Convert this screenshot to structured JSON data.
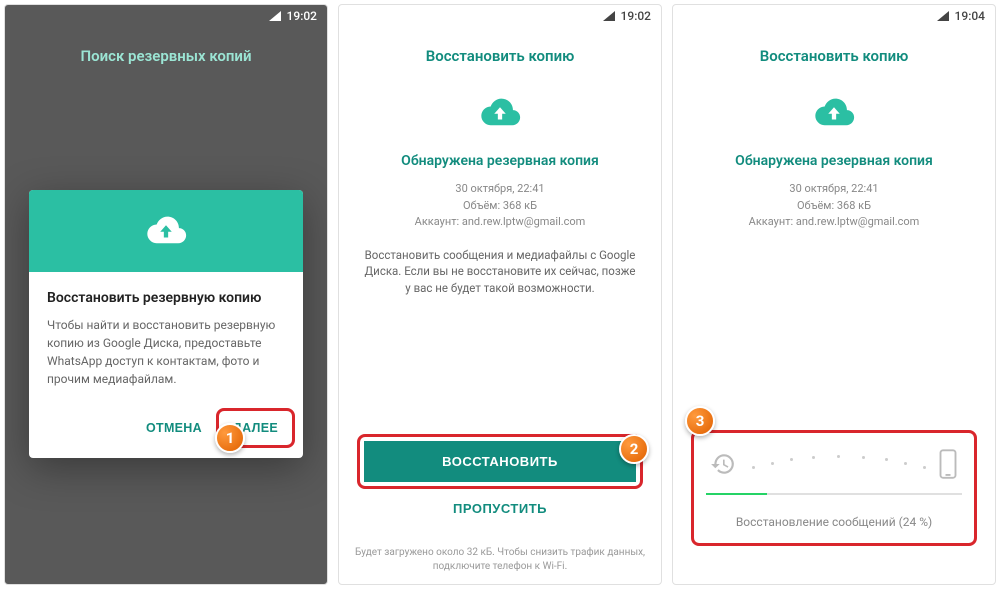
{
  "screen1": {
    "time": "19:02",
    "page_title": "Поиск резервных копий",
    "dialog": {
      "title": "Восстановить резервную копию",
      "body": "Чтобы найти и восстановить резервную копию из Google Диска, предоставьте WhatsApp доступ к контактам, фото и прочим медиафайлам.",
      "cancel": "ОТМЕНА",
      "next": "ДАЛЕЕ"
    },
    "badge": "1"
  },
  "screen2": {
    "time": "19:02",
    "page_title": "Восстановить копию",
    "backup_found": "Обнаружена резервная копия",
    "meta": {
      "date": "30 октября, 22:41",
      "size": "Объём: 368 кБ",
      "account": "Аккаунт: and.rew.lptw@gmail.com"
    },
    "description": "Восстановить сообщения и медиафайлы с Google Диска. Если вы не восстановите их сейчас, позже у вас не будет такой возможности.",
    "restore_btn": "ВОССТАНОВИТЬ",
    "skip_btn": "ПРОПУСТИТЬ",
    "footer": "Будет загружено около 32 кБ. Чтобы снизить трафик данных, подключите телефон к Wi-Fi.",
    "badge": "2"
  },
  "screen3": {
    "time": "19:04",
    "page_title": "Восстановить копию",
    "backup_found": "Обнаружена резервная копия",
    "meta": {
      "date": "30 октября, 22:41",
      "size": "Объём: 368 кБ",
      "account": "Аккаунт: and.rew.lptw@gmail.com"
    },
    "progress": {
      "percent": 24,
      "text": "Восстановление сообщений (24 %)"
    },
    "badge": "3"
  },
  "colors": {
    "accent": "#128c7e",
    "highlight": "#d9262c"
  }
}
